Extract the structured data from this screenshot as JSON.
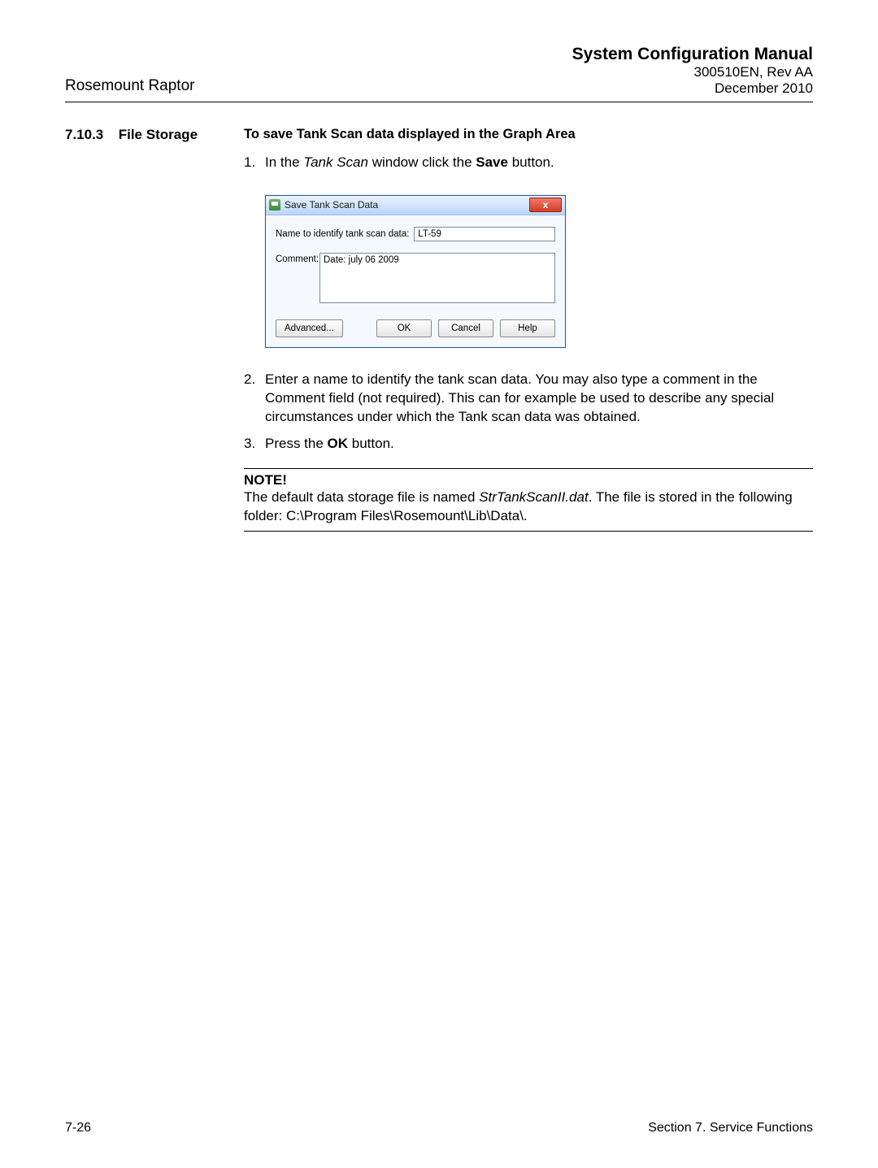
{
  "header": {
    "left": "Rosemount Raptor",
    "title": "System Configuration Manual",
    "rev": "300510EN, Rev AA",
    "date": "December 2010"
  },
  "section": {
    "num": "7.10.3",
    "title": "File Storage"
  },
  "body": {
    "subheading": "To save Tank Scan data displayed in the Graph Area",
    "step1_pre": "In the ",
    "step1_ital": "Tank Scan",
    "step1_mid": " window click the ",
    "step1_bold": "Save",
    "step1_post": " button.",
    "step2": "Enter a name to identify the tank scan data. You may also type a comment in the Comment field (not required). This can for example be used to describe any special circumstances under which the Tank scan data was obtained.",
    "step3_pre": "Press the ",
    "step3_bold": "OK",
    "step3_post": " button."
  },
  "dialog": {
    "title": "Save Tank Scan Data",
    "label_name": "Name to identify tank scan data:",
    "name_value": "LT-59",
    "label_comment": "Comment:",
    "comment_value": "Date: july 06 2009",
    "btn_advanced": "Advanced...",
    "btn_ok": "OK",
    "btn_cancel": "Cancel",
    "btn_help": "Help",
    "close_glyph": "x"
  },
  "note": {
    "title": "NOTE!",
    "pre": "The default data storage file is named ",
    "ital": "StrTankScanII.dat",
    "post": ". The file is stored in the following folder: C:\\Program Files\\Rosemount\\Lib\\Data\\."
  },
  "footer": {
    "page": "7-26",
    "section": "Section 7. Service Functions"
  }
}
